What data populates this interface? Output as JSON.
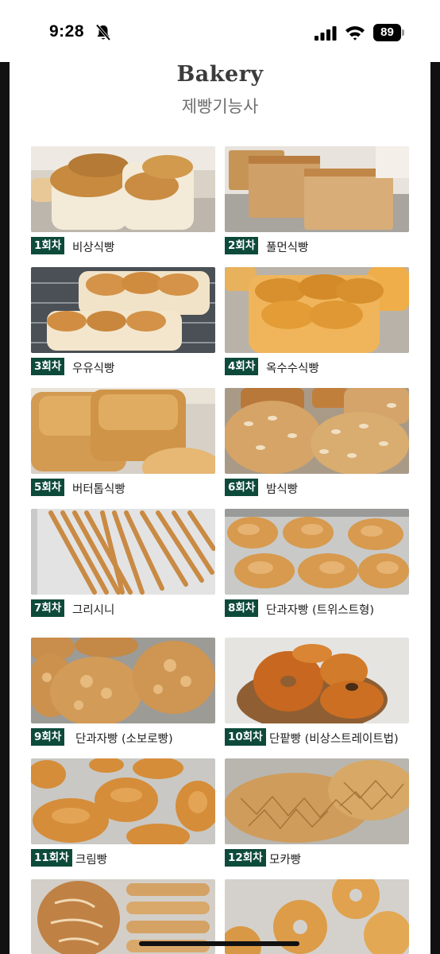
{
  "status": {
    "time": "9:28",
    "battery": "89"
  },
  "header": {
    "title": "Bakery",
    "subtitle": "제빵기능사"
  },
  "items": [
    {
      "badge": "1회차",
      "name": "비상식빵"
    },
    {
      "badge": "2회차",
      "name": "풀먼식빵"
    },
    {
      "badge": "3회차",
      "name": "우유식빵"
    },
    {
      "badge": "4회차",
      "name": "옥수수식빵"
    },
    {
      "badge": "5회차",
      "name": "버터톱식빵"
    },
    {
      "badge": "6회차",
      "name": "밤식빵"
    },
    {
      "badge": "7회차",
      "name": "그리시니"
    },
    {
      "badge": "8회차",
      "name": "단과자빵 (트위스트형)"
    },
    {
      "badge": "9회차",
      "name": "단과자빵 (소보로빵)"
    },
    {
      "badge": "10회차",
      "name": "단팥빵 (비상스트레이트법)"
    },
    {
      "badge": "11회차",
      "name": "크림빵"
    },
    {
      "badge": "12회차",
      "name": "모카빵"
    }
  ],
  "colors": {
    "badge": "#0d4a3a",
    "title": "#3b3b3b",
    "subtitle": "#6e6e6e"
  },
  "icons": [
    "bell-slash-icon",
    "cellular-signal-icon",
    "wifi-icon",
    "battery-icon"
  ]
}
